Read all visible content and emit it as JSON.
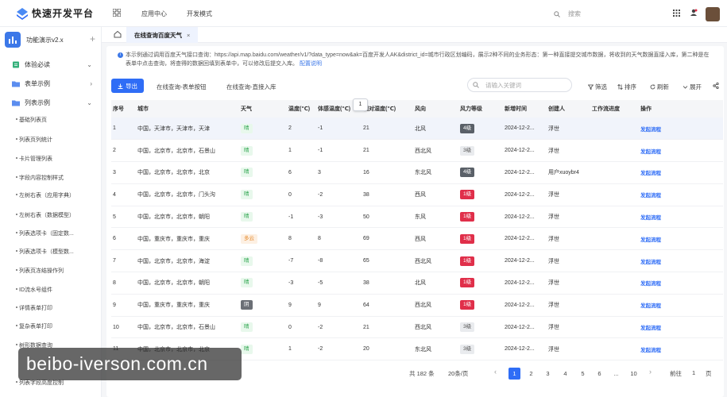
{
  "app_title": "快速开发平台",
  "top_nav": [
    "应用中心",
    "开发模式"
  ],
  "top_search_placeholder": "搜索",
  "sidebar": {
    "app_name": "功能演示v2.x",
    "groups": [
      {
        "label": "体验必读",
        "icon": "doc-icon"
      },
      {
        "label": "表单示例",
        "icon": "folder-icon"
      },
      {
        "label": "列表示例",
        "icon": "folder-icon"
      }
    ],
    "sub_items": [
      "基础列表页",
      "列表页列统计",
      "卡片管理列表",
      "字段内容控制样式",
      "左树右表（应用字典）",
      "左树右表（数据模型）",
      "列表选项卡（固定数...",
      "列表选项卡（模型数...",
      "列表页冻结操作列",
      "ID流水号组件",
      "详情表单打印",
      "复杂表单打印",
      "树形数据查询",
      "列表字段高度控制"
    ]
  },
  "active_tab": "在线查询百度天气",
  "notice": {
    "text": "本示例通过调用百度天气接口查询：https://api.map.baidu.com/weather/v1/?data_type=now&ak=百度开发人AK&district_id=城市行政区划编码，展示2种不同的业务形态：第一种直接提交城市数据，将收到的天气数据直接入库，第二种是在表单中点击查询，将查得的数据回填到表单中，可以修改后提交入库。",
    "link": "配置说明"
  },
  "toolbar": {
    "export": "导出",
    "tabs": [
      "在线查询-表单按钮",
      "在线查询-直接入库"
    ],
    "search_placeholder": "请输入关键词",
    "tools": [
      "筛选",
      "排序",
      "刷新",
      "展开"
    ]
  },
  "table": {
    "headers": [
      "序号",
      "城市",
      "天气",
      "温度(℃)",
      "体感温度(℃)",
      "相对湿度(℃)",
      "风向",
      "风力等级",
      "新增时间",
      "创建人",
      "工作流进度",
      "操作"
    ],
    "header_tooltip": "1",
    "rows": [
      [
        "1",
        "中国，天津市，天津市，天津",
        "晴",
        "2",
        "-1",
        "21",
        "北风",
        "4级",
        "2024-12-2...",
        "浮世",
        "",
        "发起流程"
      ],
      [
        "2",
        "中国，北京市，北京市，石景山",
        "晴",
        "1",
        "-1",
        "21",
        "西北风",
        "3级",
        "2024-12-2...",
        "浮世",
        "",
        "发起流程"
      ],
      [
        "3",
        "中国，北京市，北京市，北京",
        "晴",
        "6",
        "3",
        "16",
        "东北风",
        "4级",
        "2024-12-2...",
        "用户xuoybr4",
        "",
        "发起流程"
      ],
      [
        "4",
        "中国，北京市，北京市，门头沟",
        "晴",
        "0",
        "-2",
        "38",
        "西风",
        "1级",
        "2024-12-2...",
        "浮世",
        "",
        "发起流程"
      ],
      [
        "5",
        "中国，北京市，北京市，朝阳",
        "晴",
        "-1",
        "-3",
        "50",
        "东风",
        "1级",
        "2024-12-2...",
        "浮世",
        "",
        "发起流程"
      ],
      [
        "6",
        "中国，重庆市，重庆市，重庆",
        "多云",
        "8",
        "8",
        "69",
        "西风",
        "1级",
        "2024-12-2...",
        "浮世",
        "",
        "发起流程"
      ],
      [
        "7",
        "中国，北京市，北京市，海淀",
        "晴",
        "-7",
        "-8",
        "65",
        "西北风",
        "1级",
        "2024-12-2...",
        "浮世",
        "",
        "发起流程"
      ],
      [
        "8",
        "中国，北京市，北京市，朝阳",
        "晴",
        "-3",
        "-5",
        "38",
        "北风",
        "1级",
        "2024-12-2...",
        "浮世",
        "",
        "发起流程"
      ],
      [
        "9",
        "中国，重庆市，重庆市，重庆",
        "阴",
        "9",
        "9",
        "64",
        "西北风",
        "1级",
        "2024-12-2...",
        "浮世",
        "",
        "发起流程"
      ],
      [
        "10",
        "中国，北京市，北京市，石景山",
        "晴",
        "0",
        "-2",
        "21",
        "西北风",
        "3级",
        "2024-12-2...",
        "浮世",
        "",
        "发起流程"
      ],
      [
        "11",
        "中国，北京市，北京市，北京",
        "晴",
        "1",
        "-2",
        "20",
        "东北风",
        "3级",
        "2024-12-2...",
        "浮世",
        "",
        "发起流程"
      ]
    ]
  },
  "pagination": {
    "total": "共 182 条",
    "page_size": "20条/页",
    "pages": [
      "1",
      "2",
      "3",
      "4",
      "5",
      "6",
      "...",
      "10"
    ],
    "goto_label": "前往",
    "goto_value": "1",
    "page_unit": "页"
  },
  "watermark": "beibo-iverson.com.cn",
  "colors": {
    "primary": "#2f6df6",
    "danger": "#e02f4a",
    "success": "#34a853"
  }
}
